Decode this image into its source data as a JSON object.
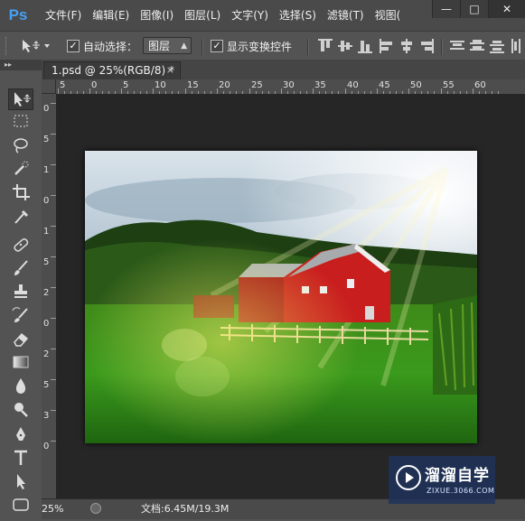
{
  "app": {
    "logo": "Ps",
    "accent": "#46a0f5"
  },
  "menu": [
    "文件(F)",
    "编辑(E)",
    "图像(I)",
    "图层(L)",
    "文字(Y)",
    "选择(S)",
    "滤镜(T)",
    "视图("
  ],
  "window_controls": {
    "minimize": "—",
    "maximize": "□",
    "close": "✕"
  },
  "options": {
    "tool_icon": "move-tool-icon",
    "auto_select": {
      "checked": true,
      "label": "自动选择："
    },
    "auto_select_target": "图层",
    "transform_controls": {
      "checked": true,
      "label": "显示变换控件"
    }
  },
  "document": {
    "tab_label": "1.psd @ 25%(RGB/8) *",
    "close": "×"
  },
  "ruler": {
    "h_labels": [
      "5",
      "0",
      "5",
      "10",
      "15",
      "20",
      "25",
      "30",
      "35",
      "40",
      "45",
      "50",
      "55",
      "60"
    ],
    "v_labels": [
      "0",
      "5",
      "1",
      "0",
      "1",
      "5",
      "2",
      "0",
      "2",
      "5",
      "3",
      "0"
    ]
  },
  "status": {
    "zoom": "25%",
    "doc_info": "文档:6.45M/19.3M"
  },
  "watermark": {
    "name": "溜溜自学",
    "url": "ZIXUE.3066.COM"
  },
  "tools": [
    "move-tool",
    "marquee-tool",
    "lasso-tool",
    "quick-select-tool",
    "crop-tool",
    "eyedropper-tool",
    "healing-brush-tool",
    "brush-tool",
    "clone-stamp-tool",
    "history-brush-tool",
    "eraser-tool",
    "gradient-tool",
    "blur-tool",
    "dodge-tool",
    "pen-tool",
    "type-tool",
    "path-select-tool",
    "shape-tool"
  ]
}
